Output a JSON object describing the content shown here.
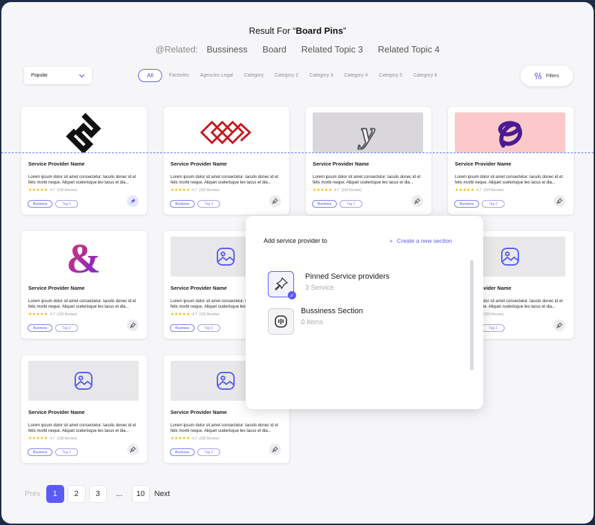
{
  "title": {
    "prefix": "Result For “",
    "bold": "Board Pins",
    "suffix": "”"
  },
  "related": {
    "label": "@Related:",
    "items": [
      "Bussiness",
      "Board",
      "Related Topic 3",
      "Related Topic 4"
    ]
  },
  "sort": {
    "value": "Popular"
  },
  "categories": [
    "All",
    "Factories",
    "Agencies Legal",
    "Category",
    "Category 2",
    "Category 3",
    "Category 4",
    "Category 5",
    "Category 6"
  ],
  "filters_label": "Filters",
  "card": {
    "name": "Service Provider Name",
    "desc": "Lorem ipsum dolor sit amet consectetur. Iaculis donec id et felis morbi neque. Aliquet scelerisque leo lacus et dia...",
    "stars": "★★★★★",
    "rating": "4.7",
    "reviews": "(150 Review)",
    "tag1": "Business",
    "tag2": "Tag 2"
  },
  "popup": {
    "heading": "Add service provider  to",
    "create": "Create a new section",
    "sections": [
      {
        "name": "Pinned Service providers",
        "sub": "3 Service"
      },
      {
        "name": "Bussiness Section",
        "sub": "0 items"
      }
    ]
  },
  "pagination": {
    "prev": "Prev",
    "pages": [
      "1",
      "2",
      "3",
      "...",
      "10"
    ],
    "next": "Next",
    "current": "1"
  },
  "colors": {
    "accent": "#5a5bf5",
    "star": "#f5b400",
    "pink_bg": "#fbc9c9",
    "grey_bg": "#d9d7db",
    "placeholder_bg": "#e8e8ea"
  }
}
